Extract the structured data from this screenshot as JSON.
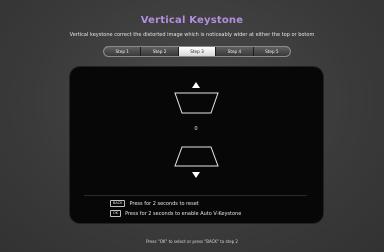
{
  "header": {
    "title": "Vertical Keystone",
    "subtitle": "Vertical keystone correct the distorted image which is noticeably wider at either the top or botom"
  },
  "steps": [
    {
      "label": "Step 1",
      "active": false
    },
    {
      "label": "Step 2",
      "active": false
    },
    {
      "label": "Step 3",
      "active": true
    },
    {
      "label": "Step 4",
      "active": false
    },
    {
      "label": "Step 5",
      "active": false
    }
  ],
  "panel": {
    "value": "0",
    "hints": [
      {
        "key": "BACK",
        "text": "Press for 2 seconds to reset"
      },
      {
        "key": "OK",
        "text": "Press for 2 seconds to enable Auto V-Keystone"
      }
    ]
  },
  "footer": {
    "text": "Press \"OK\" to select or press \"BACK\" to step 2"
  },
  "colors": {
    "title": "#b18fe0",
    "active_step": "#ffffff"
  }
}
